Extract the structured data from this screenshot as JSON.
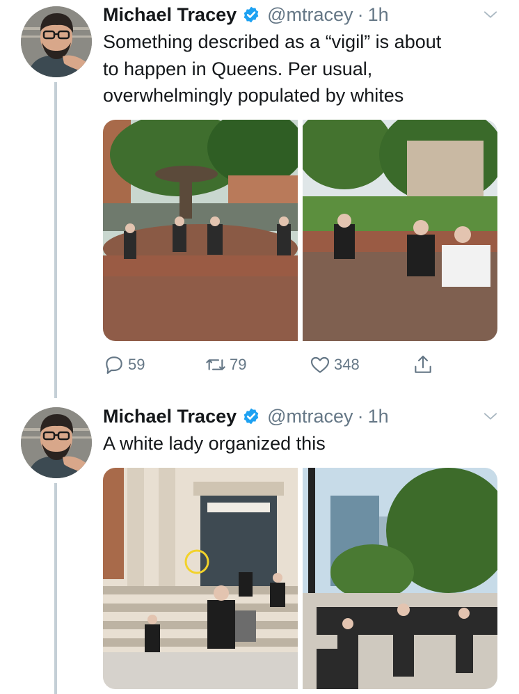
{
  "tweets": [
    {
      "author_name": "Michael Tracey",
      "handle": "@mtracey",
      "separator": "·",
      "time": "1h",
      "lines": [
        "Something described as a “vigil” is about",
        "to happen in Queens. Per usual,",
        "overwhelmingly populated by whites"
      ],
      "media": [
        {
          "icon": "photo-fountain-plaza-crowd"
        },
        {
          "icon": "photo-park-people-sitting-wall"
        }
      ],
      "reply_count": "59",
      "retweet_count": "79",
      "like_count": "348"
    },
    {
      "author_name": "Michael Tracey",
      "handle": "@mtracey",
      "separator": "·",
      "time": "1h",
      "lines": [
        "A white lady organized this"
      ],
      "media": [
        {
          "icon": "photo-courthouse-steps"
        },
        {
          "icon": "photo-street-crowd-trees"
        }
      ]
    }
  ],
  "colors": {
    "text": "#14171a",
    "muted": "#657786",
    "verified": "#1da1f2",
    "thread_line": "#c4cfd6"
  },
  "icons": [
    "avatar-icon",
    "verified-badge-icon",
    "chevron-down-icon",
    "reply-icon",
    "retweet-icon",
    "like-icon",
    "share-icon"
  ]
}
